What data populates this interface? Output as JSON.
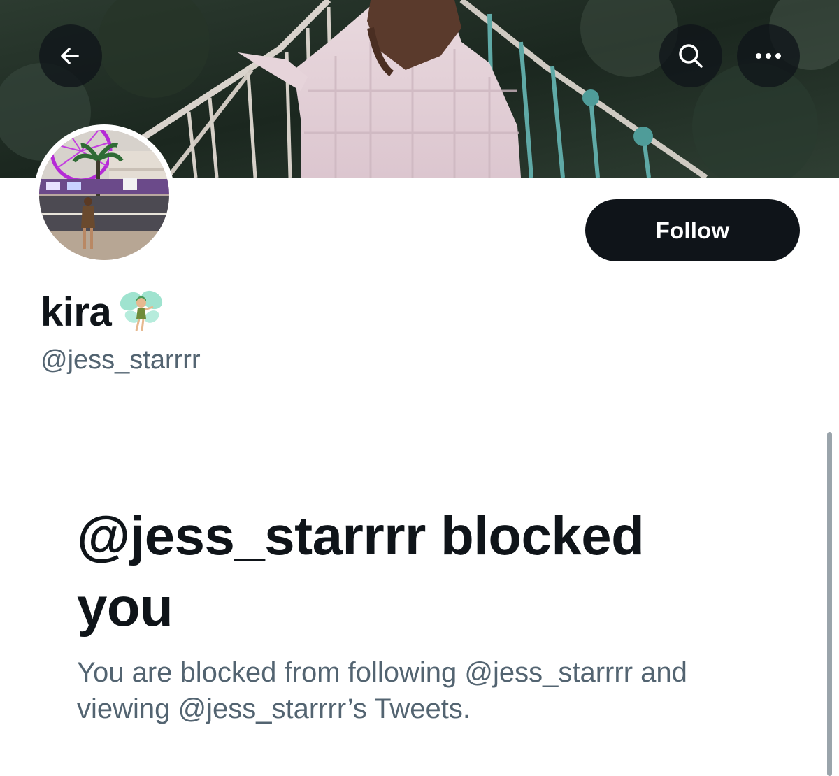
{
  "profile": {
    "display_name": "kira",
    "handle": "@jess_starrrr",
    "name_emoji": "fairy-emoji"
  },
  "header": {
    "back_icon": "back-arrow-icon",
    "search_icon": "search-icon",
    "more_icon": "more-options-icon"
  },
  "actions": {
    "follow_label": "Follow"
  },
  "blocked": {
    "title": "@jess_starrrr blocked you",
    "description": "You are blocked from following @jess_starrrr and viewing @jess_starrrr’s Tweets."
  },
  "colors": {
    "primary_text": "#0f1419",
    "secondary_text": "#536471",
    "button_bg": "#0f1419"
  }
}
